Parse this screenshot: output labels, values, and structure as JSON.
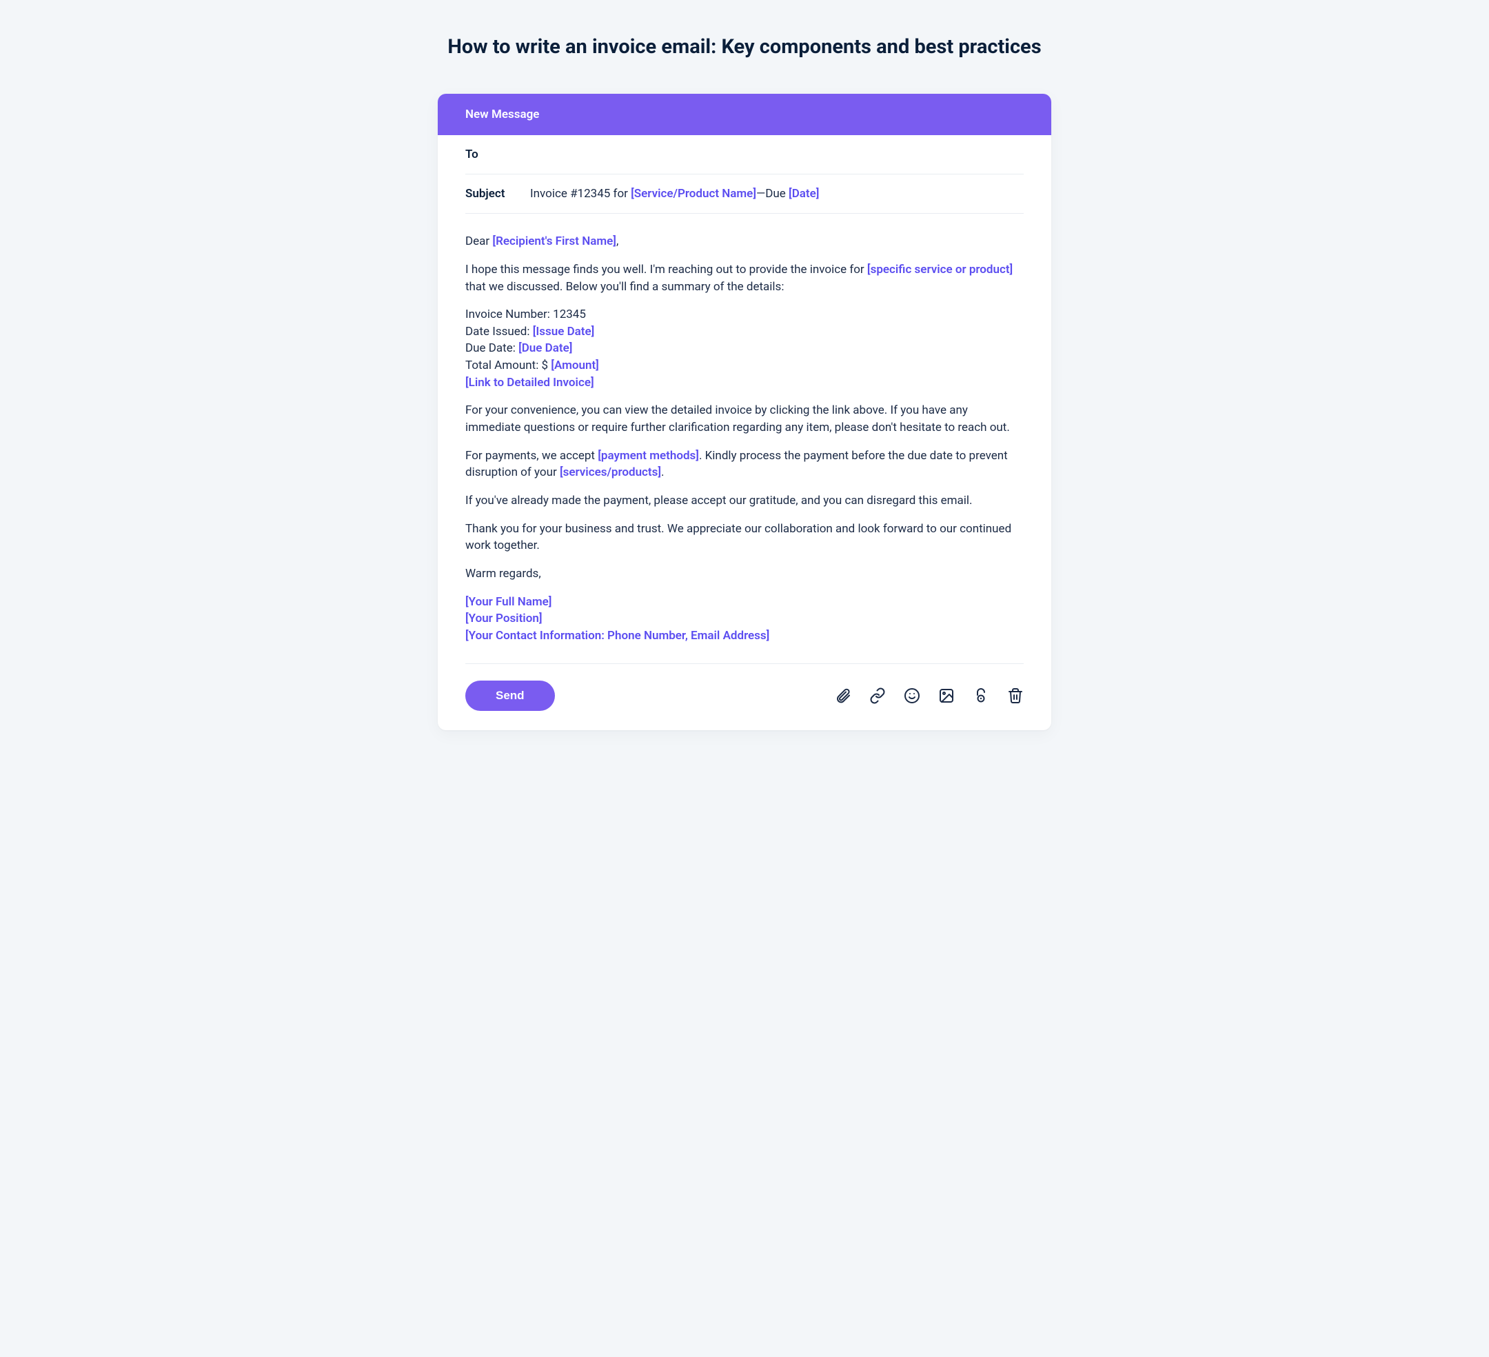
{
  "page": {
    "title": "How to write an invoice email: Key components and best practices"
  },
  "compose": {
    "header": "New Message",
    "to_label": "To",
    "subject_label": "Subject",
    "subject_prefix": "Invoice #12345 for ",
    "subject_ph_service": "[Service/Product Name]",
    "subject_dash": "—Due ",
    "subject_ph_date": "[Date]",
    "send_label": "Send"
  },
  "body": {
    "greeting_prefix": "Dear ",
    "greeting_ph": "[Recipient's First Name]",
    "greeting_suffix": ",",
    "p1a": "I hope this message finds you well. I'm reaching out to provide the invoice for ",
    "p1_ph": "[specific service or product]",
    "p1b": " that we discussed. Below you'll find a summary of the details:",
    "inv_num": "Invoice Number: 12345",
    "date_issued_label": "Date Issued: ",
    "date_issued_ph": "[Issue Date]",
    "due_date_label": "Due Date: ",
    "due_date_ph": "[Due Date]",
    "total_label": "Total Amount: $ ",
    "total_ph": "[Amount]",
    "link_ph": "[Link to Detailed Invoice]",
    "p2": "For your convenience, you can view the detailed invoice by clicking the link above. If you have any immediate questions or require further clarification regarding any item, please don't hesitate to reach out.",
    "p3a": "For payments, we accept ",
    "p3_ph1": "[payment methods]",
    "p3b": ". Kindly process the payment before the due date to prevent disruption of your ",
    "p3_ph2": "[services/products]",
    "p3c": ".",
    "p4": "If you've already made the payment, please accept our gratitude, and you can disregard this email.",
    "p5": "Thank you for your business and trust. We appreciate our collaboration and look forward to our continued work together.",
    "closing": "Warm regards,",
    "sig_name": "[Your Full Name]",
    "sig_position": "[Your Position]",
    "sig_contact": "[Your Contact Information: Phone Number, Email Address]"
  }
}
